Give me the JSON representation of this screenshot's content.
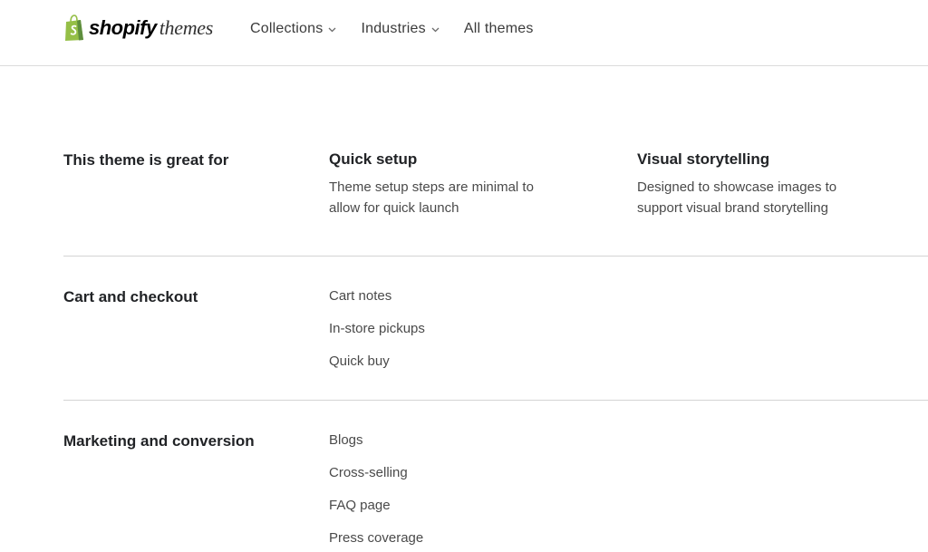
{
  "header": {
    "logo_brand": "shopify",
    "logo_suffix": "themes",
    "nav": [
      {
        "label": "Collections",
        "has_dropdown": true
      },
      {
        "label": "Industries",
        "has_dropdown": true
      },
      {
        "label": "All themes",
        "has_dropdown": false
      }
    ]
  },
  "great_for": {
    "title": "This theme is great for",
    "features": [
      {
        "title": "Quick setup",
        "description": "Theme setup steps are minimal to allow for quick launch"
      },
      {
        "title": "Visual storytelling",
        "description": "Designed to showcase images to support visual brand storytelling"
      }
    ]
  },
  "cart": {
    "title": "Cart and checkout",
    "items": [
      "Cart notes",
      "In-store pickups",
      "Quick buy"
    ]
  },
  "marketing": {
    "title": "Marketing and conversion",
    "items": [
      "Blogs",
      "Cross-selling",
      "FAQ page",
      "Press coverage"
    ]
  },
  "colors": {
    "brand_green": "#95bf47",
    "brand_dark_green": "#5e8e3e",
    "divider": "#d4d4d4"
  }
}
